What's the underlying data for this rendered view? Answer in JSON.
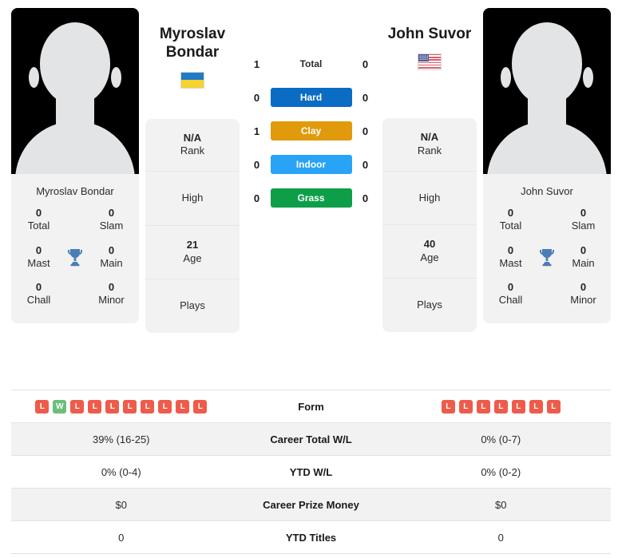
{
  "players": {
    "left": {
      "first_name": "Myroslav",
      "last_name": "Bondar",
      "full_name": "Myroslav Bondar",
      "country_flag": "ukraine-flag",
      "rank_value": "N/A",
      "rank_label": "Rank",
      "high_label": "High",
      "age_value": "21",
      "age_label": "Age",
      "plays_label": "Plays",
      "titles": [
        {
          "num": "0",
          "label": "Total"
        },
        {
          "num": "0",
          "label": "Slam"
        },
        {
          "num": "0",
          "label": "Mast"
        },
        {
          "num": "0",
          "label": "Main"
        },
        {
          "num": "0",
          "label": "Chall"
        },
        {
          "num": "0",
          "label": "Minor"
        }
      ]
    },
    "right": {
      "first_name": "John",
      "last_name": "Suvor",
      "full_name": "John Suvor",
      "country_flag": "usa-flag",
      "rank_value": "N/A",
      "rank_label": "Rank",
      "high_label": "High",
      "age_value": "40",
      "age_label": "Age",
      "plays_label": "Plays",
      "titles": [
        {
          "num": "0",
          "label": "Total"
        },
        {
          "num": "0",
          "label": "Slam"
        },
        {
          "num": "0",
          "label": "Mast"
        },
        {
          "num": "0",
          "label": "Main"
        },
        {
          "num": "0",
          "label": "Chall"
        },
        {
          "num": "0",
          "label": "Minor"
        }
      ]
    }
  },
  "head_to_head": {
    "rows": [
      {
        "label": "Total",
        "left": "1",
        "right": "0",
        "style": "plain",
        "color": ""
      },
      {
        "label": "Hard",
        "left": "0",
        "right": "0",
        "style": "badge",
        "color": "#0b6cc4"
      },
      {
        "label": "Clay",
        "left": "1",
        "right": "0",
        "style": "badge",
        "color": "#e09a0b"
      },
      {
        "label": "Indoor",
        "left": "0",
        "right": "0",
        "style": "badge",
        "color": "#29a3f5"
      },
      {
        "label": "Grass",
        "left": "0",
        "right": "0",
        "style": "badge",
        "color": "#0e9e4a"
      }
    ]
  },
  "stats_table": {
    "form": {
      "label": "Form",
      "left": [
        "L",
        "W",
        "L",
        "L",
        "L",
        "L",
        "L",
        "L",
        "L",
        "L"
      ],
      "right": [
        "L",
        "L",
        "L",
        "L",
        "L",
        "L",
        "L"
      ]
    },
    "rows": [
      {
        "label": "Career Total W/L",
        "left": "39% (16-25)",
        "right": "0% (0-7)"
      },
      {
        "label": "YTD W/L",
        "left": "0% (0-4)",
        "right": "0% (0-2)"
      },
      {
        "label": "Career Prize Money",
        "left": "$0",
        "right": "$0"
      },
      {
        "label": "YTD Titles",
        "left": "0",
        "right": "0"
      }
    ]
  },
  "icons": {
    "trophy": "trophy-icon"
  }
}
